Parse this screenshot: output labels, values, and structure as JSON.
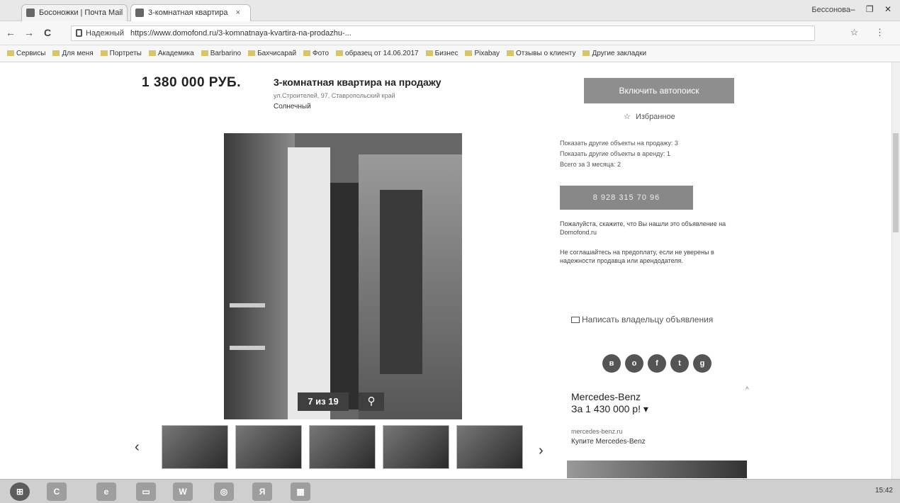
{
  "browser": {
    "tabs": [
      {
        "label": "Босоножки | Почта Mail",
        "active": false
      },
      {
        "label": "3-комнатная квартира",
        "active": true
      }
    ],
    "tab_close": "×",
    "window_user": "Бессонова",
    "window_controls": "– ❐ ✕",
    "nav": {
      "back": "←",
      "forward": "→",
      "reload": "C"
    },
    "secure_label": "Надежный",
    "url": "https://www.domofond.ru/3-komnatnaya-kvartira-na-prodazhu-...",
    "omni_icons": "☆ ⋮",
    "bookmarks": [
      "Сервисы",
      "Для меня",
      "Портреты",
      "Академика",
      "Barbarino",
      "Бахчисарай",
      "Фото",
      "образец от 14.06.2017",
      "Бизнес",
      "Pixabay",
      "Отзывы о клиенту",
      "Другие закладки"
    ]
  },
  "listing": {
    "price": "1 380 000 РУБ.",
    "title": "3-комнатная квартира на продажу",
    "address": "ул.Строителей, 97, Ставропольский край",
    "district": "Солнечный"
  },
  "gallery": {
    "counter": "7 из 19",
    "zoom_icon": "⚲",
    "prev": "‹",
    "next": "›",
    "thumb_count": 5
  },
  "sidebar": {
    "call_button": "Включить автопоиск",
    "favorites": "Избранное",
    "favorites_star": "☆",
    "links": [
      "Показать другие объекты на продажу: 3",
      "Показать другие объекты в аренду: 1",
      "Всего за 3 месяца: 2"
    ],
    "phone_button": "8 928 315 70 96",
    "notice": "Пожалуйста, скажите, что Вы нашли это объявление на Domofond.ru",
    "warning": "Не соглашайтесь на предоплату, если не уверены в надежности продавца или арендодателя.",
    "write_owner": "Написать владельцу объявления",
    "socials": [
      "в",
      "о",
      "f",
      "t",
      "g"
    ]
  },
  "ad": {
    "title": "Mercedes-Benz",
    "price": "За 1 430 000 р! ▾",
    "url": "mercedes-benz.ru",
    "subtitle": "Купите Mercedes-Benz",
    "caret": "^"
  },
  "taskbar": {
    "items": [
      "⊞",
      "C",
      "e",
      "▭",
      "W",
      "◎",
      "Я",
      "▦"
    ],
    "tray_time": "15:42"
  }
}
